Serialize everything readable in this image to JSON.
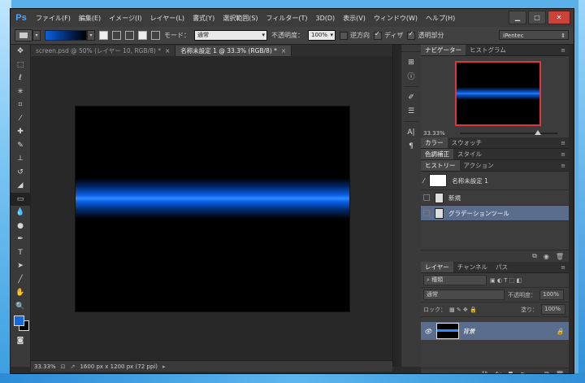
{
  "app": {
    "logo": "Ps"
  },
  "menu": [
    "ファイル(F)",
    "編集(E)",
    "イメージ(I)",
    "レイヤー(L)",
    "書式(Y)",
    "選択範囲(S)",
    "フィルター(T)",
    "3D(D)",
    "表示(V)",
    "ウィンドウ(W)",
    "ヘルプ(H)"
  ],
  "window_controls": {
    "minimize": "▁",
    "maximize": "□",
    "close": "✕"
  },
  "options": {
    "mode_label": "モード：",
    "mode_value": "通常",
    "opacity_label": "不透明度：",
    "opacity_value": "100%",
    "reverse_label": "逆方向",
    "dither_label": "ディザ",
    "transparency_label": "透明部分",
    "workspace": "iPentec",
    "gradient_colors": [
      "#0a60e0",
      "#000000"
    ]
  },
  "tabs": [
    {
      "label": "screen.psd @ 50% (レイヤー 10, RGB/8) *",
      "close": "×"
    },
    {
      "label": "名称未設定 1 @ 33.3% (RGB/8) *",
      "close": "×"
    }
  ],
  "status": {
    "zoom": "33.33%",
    "doc_size": "1600 px x 1200 px (72 ppi)"
  },
  "tools": [
    "move-icon",
    "marquee-icon",
    "lasso-icon",
    "magic-wand-icon",
    "crop-icon",
    "eyedropper-icon",
    "healing-brush-icon",
    "brush-icon",
    "clone-stamp-icon",
    "history-brush-icon",
    "eraser-icon",
    "gradient-icon",
    "blur-icon",
    "dodge-icon",
    "pen-icon",
    "type-icon",
    "path-select-icon",
    "line-icon",
    "hand-icon",
    "zoom-icon"
  ],
  "colors": {
    "foreground": "#1468d8",
    "background": "#000000",
    "accent_select": "#5a6d8c"
  },
  "navigator": {
    "tabs": [
      "ナビゲーター",
      "ヒストグラム"
    ],
    "zoom": "33.33%"
  },
  "color_panel": {
    "tabs": [
      "カラー",
      "スウォッチ"
    ]
  },
  "adjust_panel": {
    "tabs": [
      "色調補正",
      "スタイル"
    ]
  },
  "history": {
    "tabs": [
      "ヒストリー",
      "アクション"
    ],
    "snapshot": "名称未設定 1",
    "items": [
      "新規",
      "グラデーションツール"
    ]
  },
  "layers": {
    "tabs": [
      "レイヤー",
      "チャンネル",
      "パス"
    ],
    "filter": "種類",
    "blend": "通常",
    "opacity_label": "不透明度：",
    "opacity_value": "100%",
    "lock_label": "ロック：",
    "fill_label": "塗り：",
    "fill_value": "100%",
    "layer_name": "背景"
  }
}
